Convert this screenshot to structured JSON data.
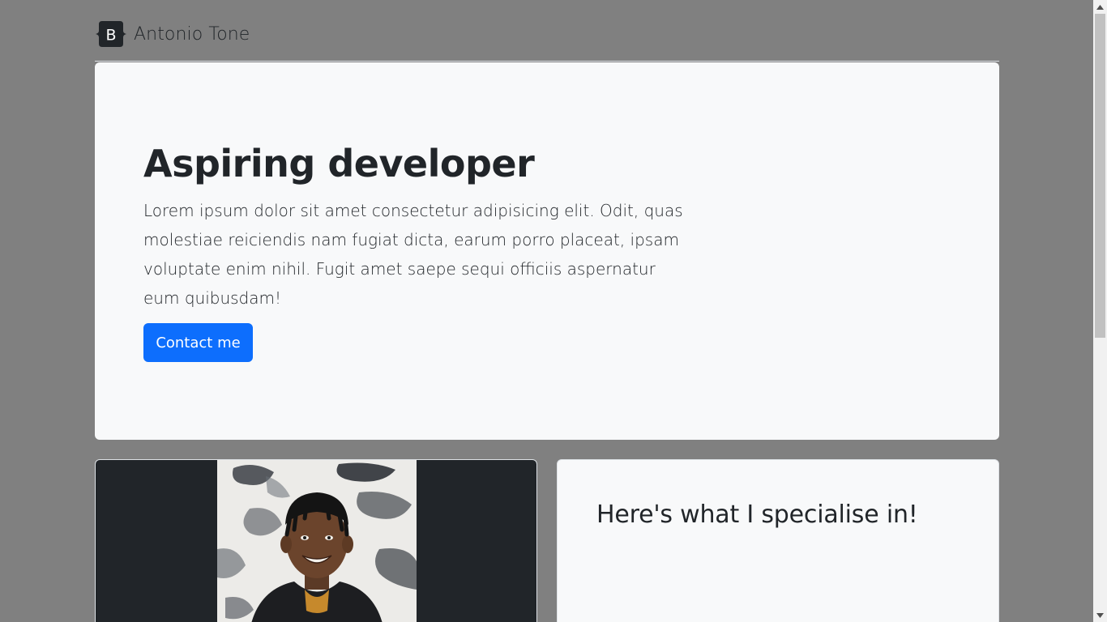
{
  "header": {
    "logo_icon": "bootstrap-logo-icon",
    "logo_letter": "B",
    "brand_name": "Antonio Tone"
  },
  "hero": {
    "title": "Aspiring developer",
    "description": "Lorem ipsum dolor sit amet consectetur adipisicing elit. Odit, quas molestiae reiciendis nam fugiat dicta, earum porro placeat, ipsam voluptate enim nihil. Fugit amet saepe sequi officiis aspernatur eum quibusdam!",
    "button_label": "Contact me"
  },
  "photo_card": {
    "image": "portrait-photo"
  },
  "specialise_card": {
    "title": "Here's what I specialise in!"
  },
  "colors": {
    "page_background": "#808080",
    "card_background": "#f8f9fa",
    "primary_button": "#0d6efd",
    "dark_card": "#212529"
  }
}
